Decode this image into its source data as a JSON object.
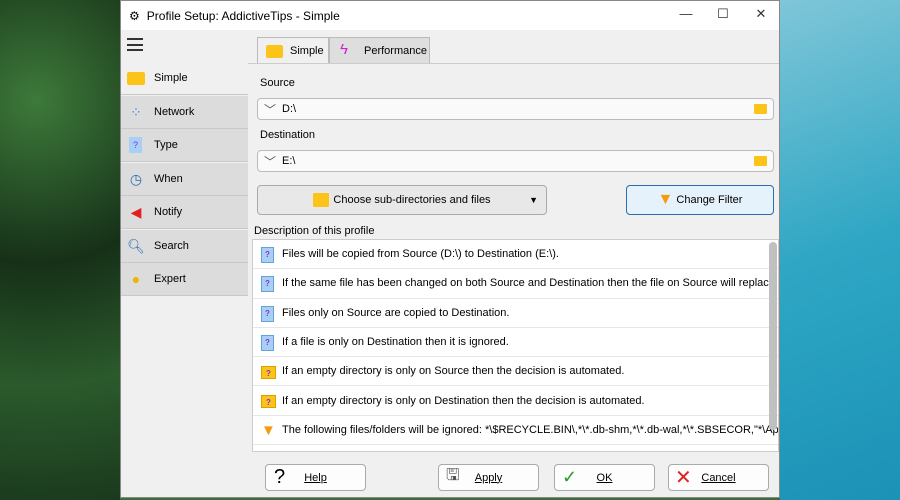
{
  "window": {
    "title": "Profile Setup: AddictiveTips - Simple",
    "minimize": "—",
    "maximize": "☐",
    "close": "✕"
  },
  "sidebar": {
    "items": [
      {
        "label": "Simple",
        "icon": "folder-icon"
      },
      {
        "label": "Network",
        "icon": "network-icon"
      },
      {
        "label": "Type",
        "icon": "document-icon"
      },
      {
        "label": "When",
        "icon": "clock-icon"
      },
      {
        "label": "Notify",
        "icon": "megaphone-icon"
      },
      {
        "label": "Search",
        "icon": "magnifier-icon"
      },
      {
        "label": "Expert",
        "icon": "lightbulb-icon"
      }
    ]
  },
  "tabs": [
    {
      "label": "Simple",
      "selected": true
    },
    {
      "label": "Performance",
      "selected": false
    }
  ],
  "source": {
    "label": "Source",
    "value": "D:\\"
  },
  "destination": {
    "label": "Destination",
    "value": "E:\\"
  },
  "choose_button": "Choose sub-directories and files",
  "filter_button": "Change Filter",
  "description": {
    "label": "Description of this profile",
    "rows": [
      {
        "icon": "doc",
        "text": "Files will be copied from Source (D:\\) to Destination (E:\\)."
      },
      {
        "icon": "doc",
        "text": "If the same file has been changed on both Source and Destination then the file on Source will replace the file..."
      },
      {
        "icon": "doc",
        "text": "Files only on Source are copied to Destination."
      },
      {
        "icon": "doc",
        "text": "If a file is only on Destination then it is ignored."
      },
      {
        "icon": "folder",
        "text": "If an empty directory is only on Source then the decision is automated."
      },
      {
        "icon": "folder",
        "text": "If an empty directory is only on Destination then the decision is automated."
      },
      {
        "icon": "filter",
        "text": "The following files/folders will be ignored: *\\$RECYCLE.BIN\\,*\\*.db-shm,*\\*.db-wal,*\\*.SBSECOR,\"*\\AppDat..."
      }
    ]
  },
  "buttons": {
    "help": "Help",
    "apply": "Apply",
    "ok": "OK",
    "cancel": "Cancel"
  }
}
